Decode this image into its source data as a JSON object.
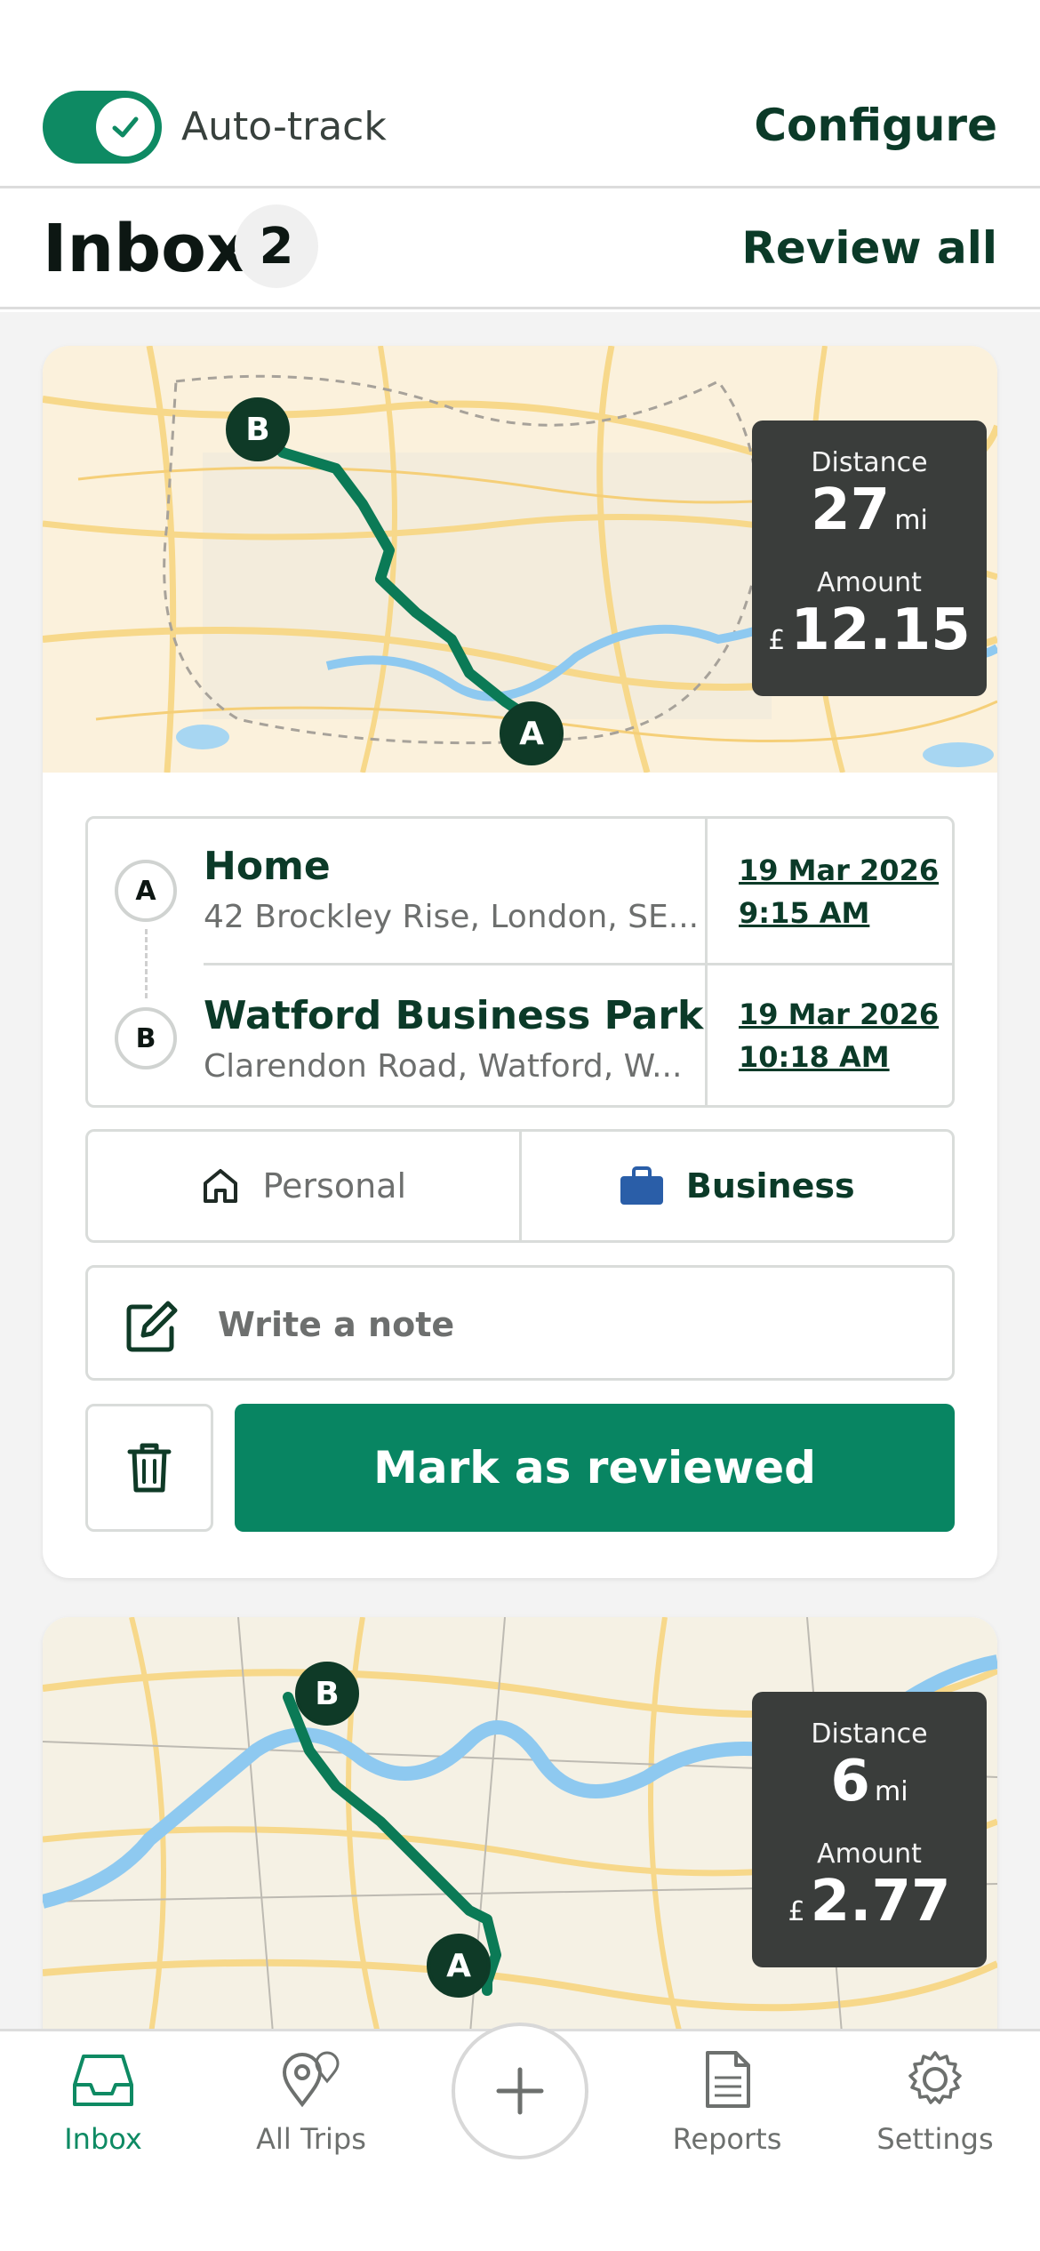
{
  "header": {
    "autotrack_label": "Auto-track",
    "autotrack_on": true,
    "configure_label": "Configure"
  },
  "inbox": {
    "title": "Inbox",
    "count": "2",
    "review_all_label": "Review all"
  },
  "trips": [
    {
      "distance_label": "Distance",
      "distance_value": "27",
      "distance_unit": "mi",
      "amount_label": "Amount",
      "currency": "£",
      "amount_value": "12.15",
      "start": {
        "marker": "A",
        "name": "Home",
        "address": "42 Brockley Rise, London, SE...",
        "date": "19 Mar 2026",
        "time": "9:15 AM"
      },
      "end": {
        "marker": "B",
        "name": "Watford Business Park",
        "address": "Clarendon Road, Watford, W...",
        "date": "19 Mar 2026",
        "time": "10:18 AM"
      },
      "purpose_personal_label": "Personal",
      "purpose_business_label": "Business",
      "selected_purpose": "Business",
      "note_placeholder": "Write a note",
      "mark_reviewed_label": "Mark as reviewed"
    },
    {
      "distance_label": "Distance",
      "distance_value": "6",
      "distance_unit": "mi",
      "amount_label": "Amount",
      "currency": "£",
      "amount_value": "2.77",
      "start": {
        "marker": "A"
      },
      "end": {
        "marker": "B"
      }
    }
  ],
  "nav": {
    "inbox": "Inbox",
    "all_trips": "All Trips",
    "reports": "Reports",
    "settings": "Settings",
    "active": "Inbox"
  },
  "colors": {
    "brand_green": "#088562",
    "dark_green": "#0b3a28",
    "business_blue": "#2a5ea8"
  }
}
